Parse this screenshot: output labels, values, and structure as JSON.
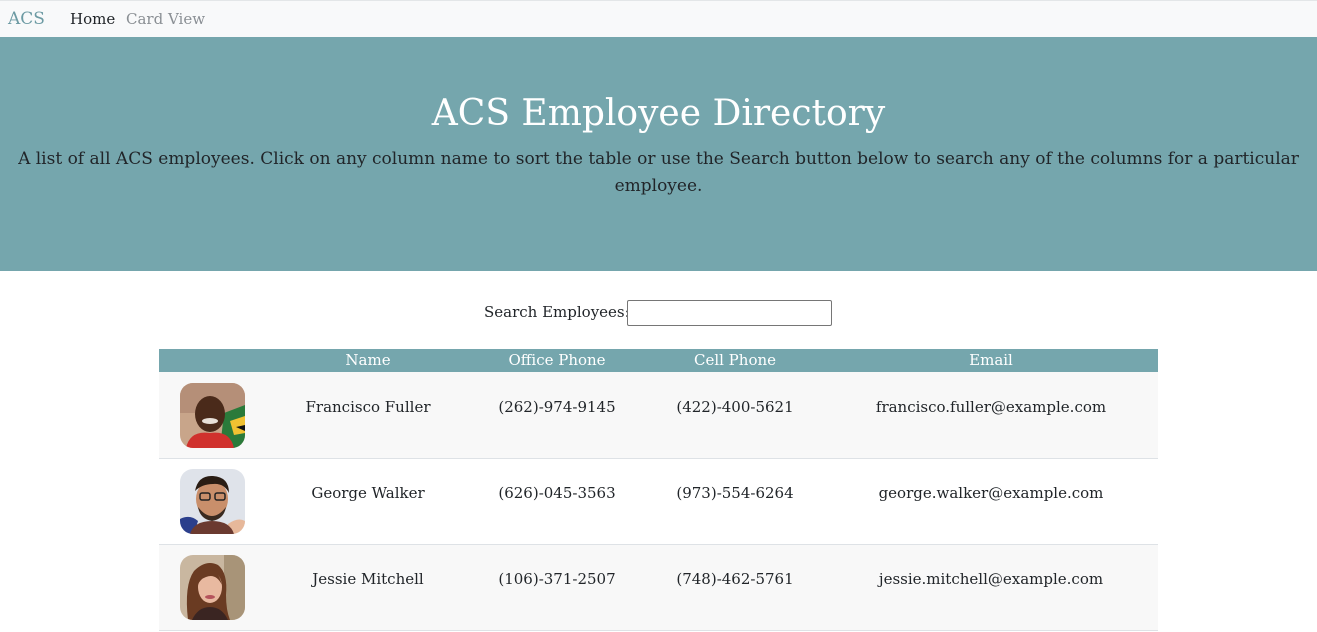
{
  "nav": {
    "brand": "ACS",
    "links": [
      {
        "label": "Home"
      },
      {
        "label": "Card View"
      }
    ]
  },
  "header": {
    "title": "ACS Employee Directory",
    "description": "A list of all ACS employees. Click on any column name to sort the table or use the Search button below to search any of the columns for a particular employee."
  },
  "search": {
    "label": "Search Employees:",
    "value": ""
  },
  "table": {
    "columns": [
      "Name",
      "Office Phone",
      "Cell Phone",
      "Email"
    ],
    "rows": [
      {
        "name": "Francisco Fuller",
        "office_phone": "(262)-974-9145",
        "cell_phone": "(422)-400-5621",
        "email": "francisco.fuller@example.com",
        "avatar_icon": "avatar-photo"
      },
      {
        "name": "George Walker",
        "office_phone": "(626)-045-3563",
        "cell_phone": "(973)-554-6264",
        "email": "george.walker@example.com",
        "avatar_icon": "avatar-photo"
      },
      {
        "name": "Jessie Mitchell",
        "office_phone": "(106)-371-2507",
        "cell_phone": "(748)-462-5761",
        "email": "jessie.mitchell@example.com",
        "avatar_icon": "avatar-photo"
      }
    ]
  },
  "colors": {
    "accent": "#75a6ad",
    "brand": "#6c9aa3",
    "navbar_bg": "#f8f9fa",
    "row_stripe": "#f8f8f8"
  }
}
